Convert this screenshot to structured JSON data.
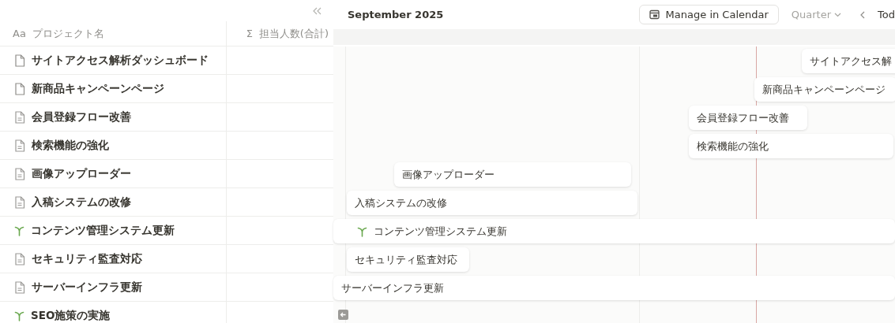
{
  "table": {
    "columns": [
      {
        "icon_text": "Aa",
        "label": "プロジェクト名"
      },
      {
        "icon_text": "Σ",
        "label": "担当人数(合計)"
      }
    ],
    "rows": [
      {
        "kind": "page",
        "name": "サイトアクセス解析ダッシュボード"
      },
      {
        "kind": "page",
        "name": "新商品キャンペーンページ"
      },
      {
        "kind": "doc",
        "name": "会員登録フロー改善"
      },
      {
        "kind": "doc",
        "name": "検索機能の強化"
      },
      {
        "kind": "doc",
        "name": "画像アップローダー"
      },
      {
        "kind": "doc",
        "name": "入稿システムの改修"
      },
      {
        "kind": "sprout",
        "name": "コンテンツ管理システム更新"
      },
      {
        "kind": "doc",
        "name": "セキュリティ監査対応"
      },
      {
        "kind": "doc",
        "name": "サーバーインフラ更新"
      },
      {
        "kind": "sprout",
        "name": "SEO施策の実施"
      }
    ]
  },
  "timeline": {
    "month": "September 2025",
    "manage_button": "Manage in Calendar",
    "view": "Quarter",
    "today_button": "Tod",
    "bars": [
      {
        "kind": "plain",
        "label": "サイトアクセス解"
      },
      {
        "kind": "plain",
        "label": "新商品キャンペーンページ"
      },
      {
        "kind": "plain",
        "label": "会員登録フロー改善"
      },
      {
        "kind": "plain",
        "label": "検索機能の強化"
      },
      {
        "kind": "plain",
        "label": "画像アップローダー"
      },
      {
        "kind": "plain",
        "label": "入稿システムの改修"
      },
      {
        "kind": "sprout",
        "label": "コンテンツ管理システム更新"
      },
      {
        "kind": "plain",
        "label": "セキュリティ監査対応"
      },
      {
        "kind": "plain",
        "label": "サーバーインフラ更新"
      },
      {
        "kind": "back"
      }
    ]
  }
}
